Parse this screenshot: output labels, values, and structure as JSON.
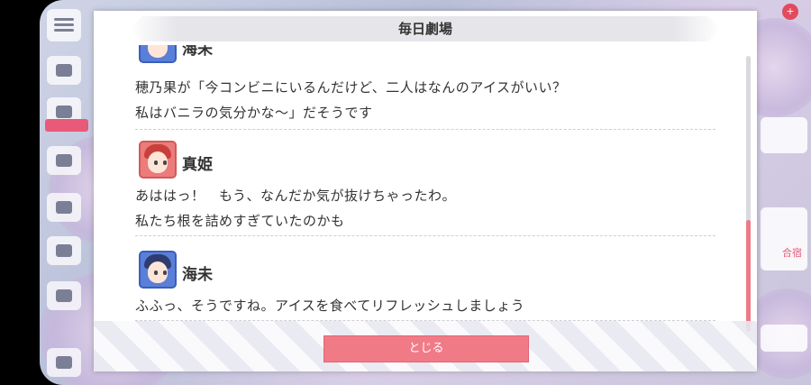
{
  "dialog": {
    "title": "毎日劇場",
    "close_label": "とじる"
  },
  "log": {
    "top_partial_name": "海未",
    "entries": [
      {
        "speaker": "",
        "lines": [
          "穂乃果が「今コンビニにいるんだけど、二人はなんのアイスがいい？",
          "私はバニラの気分かな〜」だそうです"
        ]
      },
      {
        "speaker": "真姫",
        "lines": [
          "あははっ！　もう、なんだか気が抜けちゃったわ。",
          "私たち根を詰めすぎていたのかも"
        ]
      },
      {
        "speaker": "海未",
        "lines": [
          "ふふっ、そうですね。アイスを食べてリフレッシュしましょう"
        ]
      }
    ]
  },
  "background": {
    "right_label": "合宿"
  },
  "scroll": {
    "position_fraction": 1.0
  },
  "colors": {
    "close_button": "#f07b87",
    "scroll_thumb": "#ec7a86",
    "title_bar": "#e6e6ea"
  }
}
